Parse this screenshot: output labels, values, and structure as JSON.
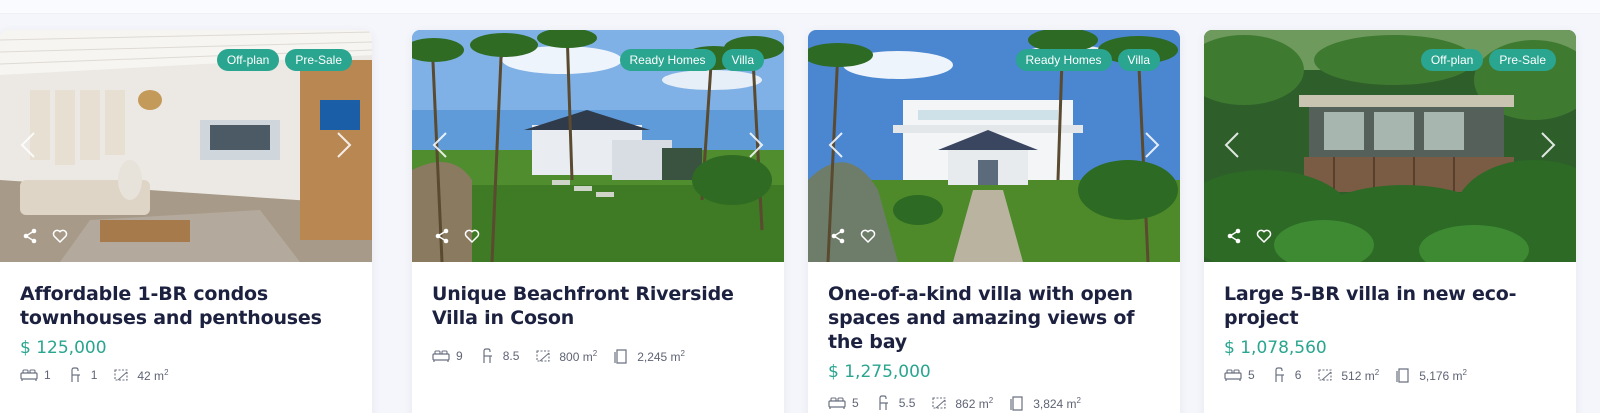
{
  "cards": [
    {
      "badges": [
        "Ready Homes",
        "Villa"
      ],
      "title": "Unique Beachfront Riverside Villa in Coson",
      "price": "",
      "beds": "9",
      "baths": "8.5",
      "living_area": "800 m",
      "lot_area": "2,245 m",
      "area_unit_sup": "2"
    },
    {
      "badges": [
        "Ready Homes",
        "Villa"
      ],
      "title": "One-of-a-kind villa with open spaces and amazing views of the bay",
      "price": "$ 1,275,000",
      "beds": "5",
      "baths": "5.5",
      "living_area": "862 m",
      "lot_area": "3,824 m",
      "area_unit_sup": "2"
    },
    {
      "badges": [
        "Off-plan",
        "Pre-Sale"
      ],
      "title": "Large 5-BR villa in new eco-project",
      "price": "$ 1,078,560",
      "beds": "5",
      "baths": "6",
      "living_area": "512 m",
      "lot_area": "5,176 m",
      "area_unit_sup": "2"
    },
    {
      "badges": [
        "Off-plan",
        "Pre-Sale"
      ],
      "title": "Affordable 1-BR condos townhouses and penthouses",
      "price": "$ 125,000",
      "beds": "1",
      "baths": "1",
      "living_area": "42 m",
      "lot_area": "",
      "area_unit_sup": "2"
    }
  ],
  "colors": {
    "accent": "#2aa58f",
    "title": "#1d2140",
    "meta": "#5f6475"
  },
  "icons": {
    "share": "share-icon",
    "favorite": "heart-icon",
    "prev": "chevron-left-icon",
    "next": "chevron-right-icon",
    "beds": "bed-icon",
    "baths": "bath-icon",
    "living_area": "area-icon",
    "lot_area": "lot-icon"
  }
}
